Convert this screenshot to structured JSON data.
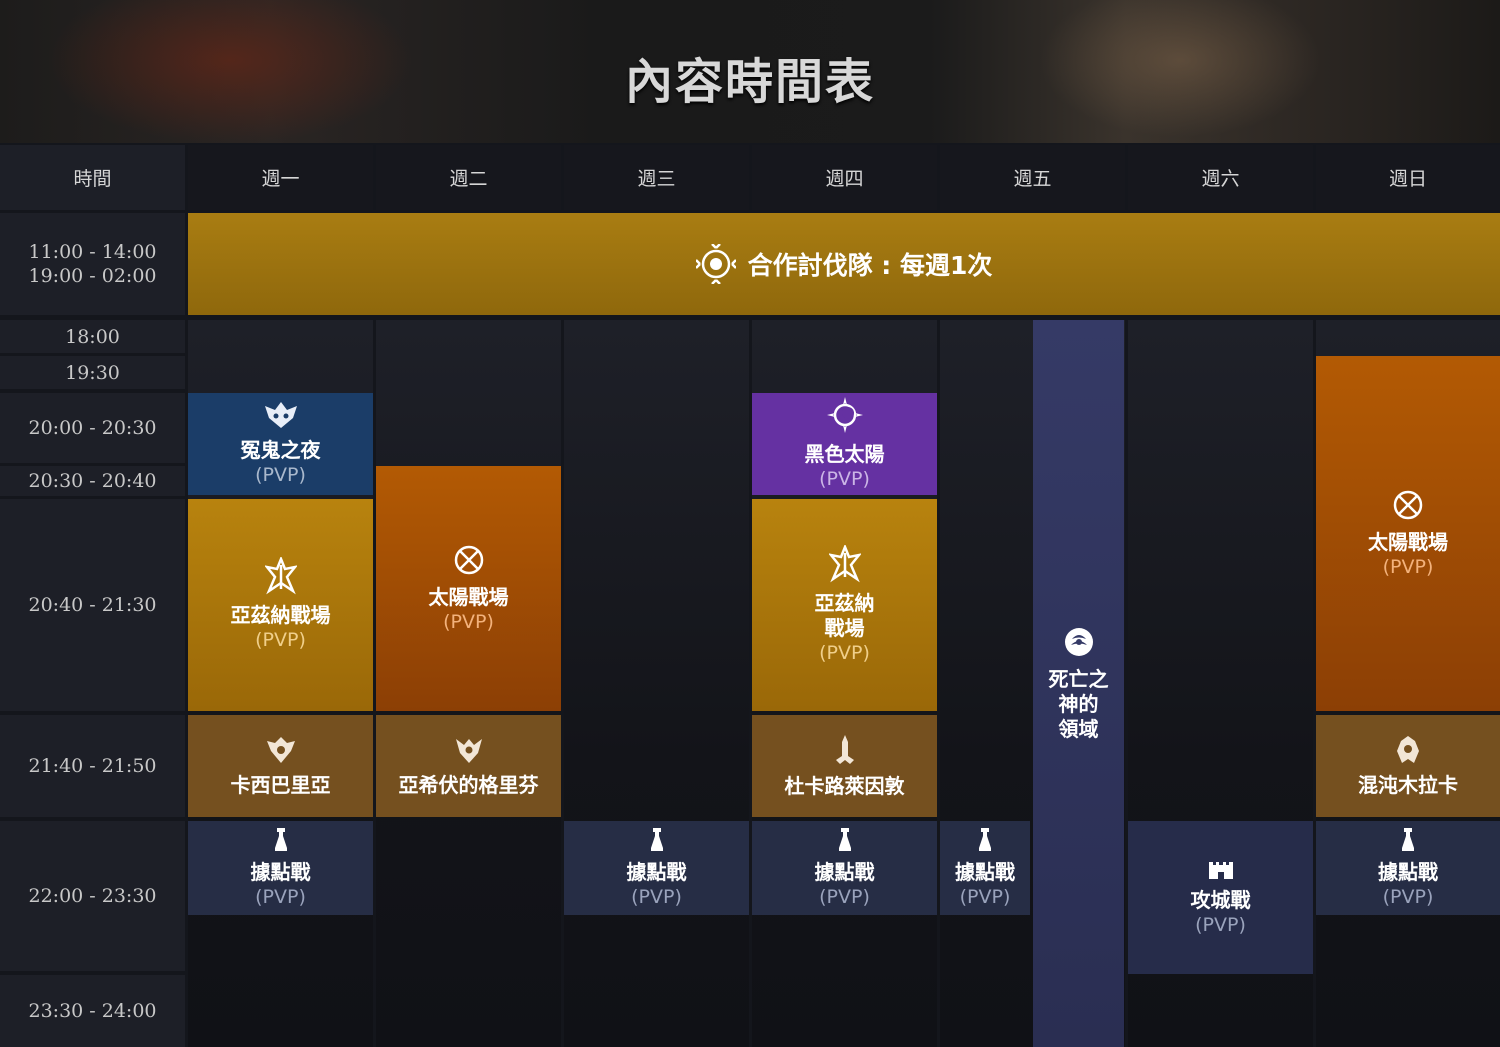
{
  "banner": {
    "title": "內容時間表"
  },
  "header": {
    "time_label": "時間",
    "days": [
      "週一",
      "週二",
      "週三",
      "週四",
      "週五",
      "週六",
      "週日"
    ]
  },
  "times": {
    "coop_1": "11:00 - 14:00",
    "coop_2": "19:00 - 02:00",
    "t1800": "18:00",
    "t1930": "19:30",
    "t2000": "20:00 - 20:30",
    "t2030": "20:30 - 20:40",
    "t2040": "20:40 - 21:30",
    "t2140": "21:40 - 21:50",
    "t2200": "22:00 - 23:30",
    "t2330": "23:30 - 24:00"
  },
  "coop": {
    "label": "合作討伐隊 : 每週1次"
  },
  "events": {
    "wraith_night": {
      "name": "冤鬼之夜",
      "tag": "(PVP)"
    },
    "azena_mon": {
      "name": "亞茲納戰場",
      "tag": "(PVP)"
    },
    "sun_tue": {
      "name": "太陽戰場",
      "tag": "(PVP)"
    },
    "black_sun": {
      "name": "黑色太陽",
      "tag": "(PVP)"
    },
    "azena_thu": {
      "name1": "亞茲納",
      "name2": "戰場",
      "tag": "(PVP)"
    },
    "reaper": {
      "line1": "死亡之",
      "line2": "神的",
      "line3": "領域"
    },
    "sun_sun": {
      "name": "太陽戰場",
      "tag": "(PVP)"
    },
    "kasibaria": {
      "name": "卡西巴里亞"
    },
    "griffin": {
      "name": "亞希伏的格里芬"
    },
    "dukaru": {
      "name": "杜卡路萊因敦"
    },
    "chaos": {
      "name": "混沌木拉卡"
    },
    "stronghold_mon": {
      "name": "據點戰",
      "tag": "(PVP)"
    },
    "stronghold_wed": {
      "name": "據點戰",
      "tag": "(PVP)"
    },
    "stronghold_thu": {
      "name": "據點戰",
      "tag": "(PVP)"
    },
    "stronghold_fri": {
      "name": "據點戰",
      "tag": "(PVP)"
    },
    "siege_sat": {
      "name": "攻城戰",
      "tag": "(PVP)"
    },
    "stronghold_sun": {
      "name": "據點戰",
      "tag": "(PVP)"
    }
  }
}
